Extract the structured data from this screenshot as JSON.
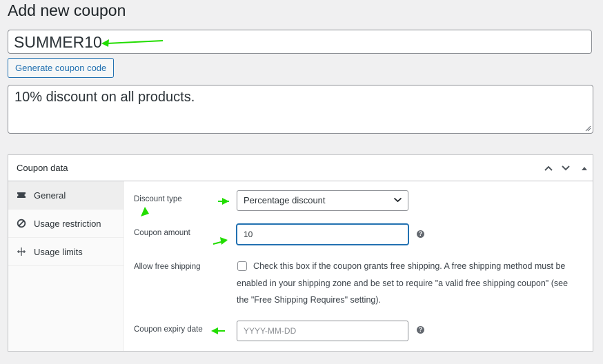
{
  "page": {
    "title": "Add new coupon"
  },
  "coupon_code": {
    "value": "SUMMER10"
  },
  "generate_button": {
    "label": "Generate coupon code"
  },
  "description": {
    "value": "10% discount on all products."
  },
  "coupon_data": {
    "title": "Coupon data",
    "tabs": [
      {
        "label": "General",
        "icon": "ticket-icon",
        "active": true
      },
      {
        "label": "Usage restriction",
        "icon": "block-icon",
        "active": false
      },
      {
        "label": "Usage limits",
        "icon": "limits-icon",
        "active": false
      }
    ],
    "fields": {
      "discount_type": {
        "label": "Discount type",
        "value": "Percentage discount"
      },
      "coupon_amount": {
        "label": "Coupon amount",
        "value": "10"
      },
      "free_shipping": {
        "label": "Allow free shipping",
        "description": "Check this box if the coupon grants free shipping. A free shipping method must be enabled in your shipping zone and be set to require \"a valid free shipping coupon\" (see the \"Free Shipping Requires\" setting).",
        "checked": false
      },
      "expiry_date": {
        "label": "Coupon expiry date",
        "placeholder": "YYYY-MM-DD",
        "value": ""
      }
    },
    "help_icon": "?"
  },
  "colors": {
    "accent": "#2271b1",
    "annotation_arrow": "#22dd00"
  }
}
